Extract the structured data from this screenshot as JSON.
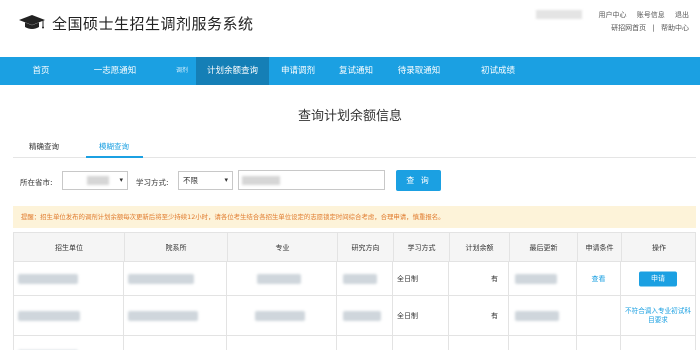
{
  "header": {
    "title": "全国硕士生招生调剂服务系统",
    "top_links": [
      "用户中心",
      "账号信息",
      "退出"
    ],
    "bottom_links": [
      "研招网首页",
      "帮助中心"
    ],
    "bottom_sep": "|"
  },
  "nav": {
    "items": [
      {
        "label": "首页"
      },
      {
        "label": "一志愿通知"
      },
      {
        "label": "调剂"
      },
      {
        "label": "计划余额查询"
      },
      {
        "label": "申请调剂"
      },
      {
        "label": "复试通知"
      },
      {
        "label": "待录取通知"
      },
      {
        "label": "初试成绩"
      }
    ],
    "active_index": 3
  },
  "page_title": "查询计划余额信息",
  "tabs": [
    "精确查询",
    "模糊查询"
  ],
  "active_tab": 1,
  "filters": {
    "province_label": "所在省市:",
    "study_mode_label": "学习方式:",
    "study_mode_value": "不限",
    "query_button": "查 询"
  },
  "notice": "提醒：招生单位发布的调剂计划余额每次更新后将至少持续12小时，请各位考生结合各招生单位设定的志愿锁定时间综合考虑，合理申请，慎重报名。",
  "table": {
    "headers": [
      "招生单位",
      "院系所",
      "专业",
      "研究方向",
      "学习方式",
      "计划余额",
      "最后更新",
      "申请条件",
      "操作"
    ],
    "rows": [
      {
        "study_mode": "全日制",
        "quota": "有",
        "condition": "查看",
        "action": "申请"
      },
      {
        "study_mode": "全日制",
        "quota": "有",
        "condition": "不符合调入专业初试科目要求",
        "action": ""
      }
    ]
  },
  "colors": {
    "primary": "#1ba0e2",
    "nav_active": "#157fb6",
    "notice_bg": "#fdf3d9",
    "notice_text": "#e07a2c"
  }
}
